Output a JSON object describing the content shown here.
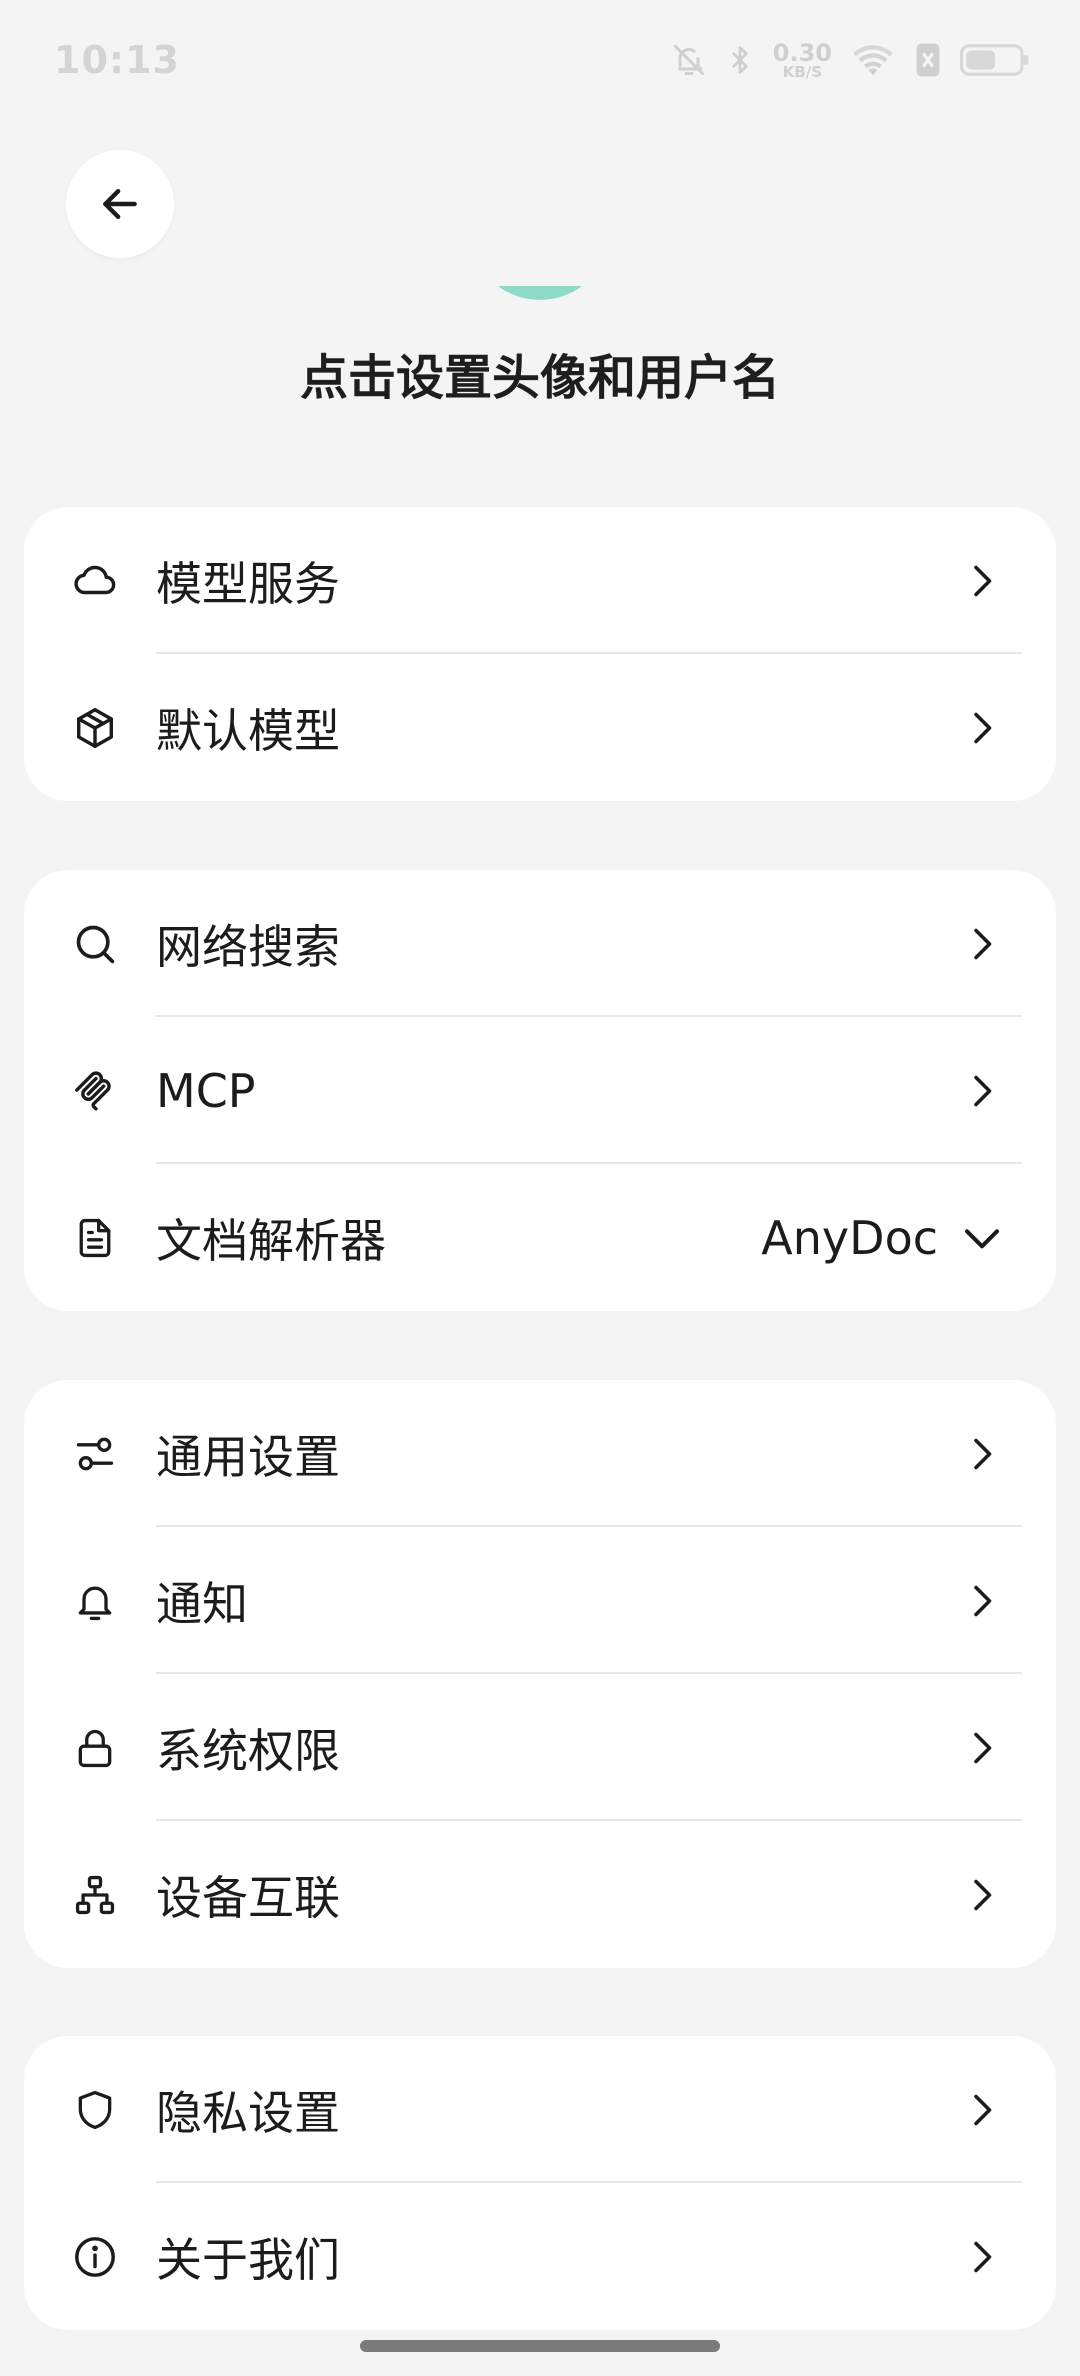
{
  "status_bar": {
    "time": "10:13",
    "net_speed_value": "0.30",
    "net_speed_unit": "KB/S",
    "icons": [
      "bell-muted-icon",
      "bluetooth-icon",
      "wifi-icon",
      "sim-icon",
      "battery-icon"
    ]
  },
  "header": {
    "back_icon": "arrow-left-icon",
    "profile_hint": "点击设置头像和用户名",
    "avatar_color": "#8fd9c8"
  },
  "groups": [
    {
      "items": [
        {
          "icon": "cloud-icon",
          "label": "模型服务"
        },
        {
          "icon": "cube-icon",
          "label": "默认模型"
        }
      ]
    },
    {
      "items": [
        {
          "icon": "search-icon",
          "label": "网络搜索"
        },
        {
          "icon": "mcp-icon",
          "label": "MCP"
        },
        {
          "icon": "document-icon",
          "label": "文档解析器",
          "value": "AnyDoc"
        }
      ]
    },
    {
      "items": [
        {
          "icon": "sliders-icon",
          "label": "通用设置"
        },
        {
          "icon": "bell-icon",
          "label": "通知"
        },
        {
          "icon": "lock-icon",
          "label": "系统权限"
        },
        {
          "icon": "network-icon",
          "label": "设备互联"
        }
      ]
    },
    {
      "items": [
        {
          "icon": "shield-icon",
          "label": "隐私设置"
        },
        {
          "icon": "info-icon",
          "label": "关于我们"
        }
      ]
    }
  ]
}
